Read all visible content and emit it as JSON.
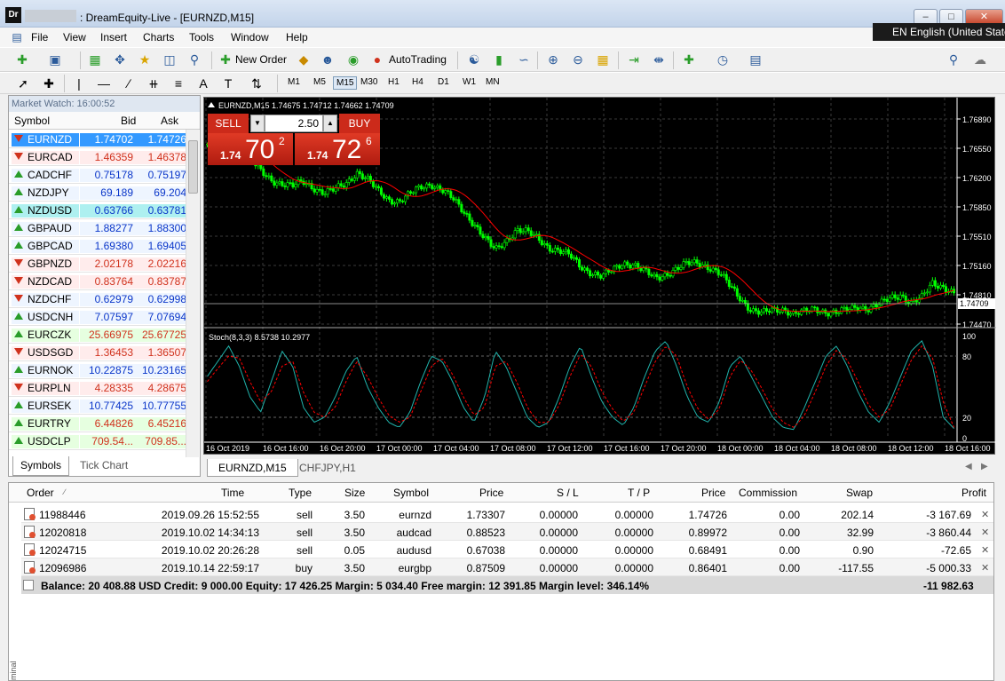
{
  "window": {
    "app_badge": "Dr",
    "title": ": DreamEquity-Live - [EURNZD,M15]",
    "language": "EN English (United States)"
  },
  "menu": [
    "File",
    "View",
    "Insert",
    "Charts",
    "Tools",
    "Window",
    "Help"
  ],
  "toolbar": {
    "new_order": "New Order",
    "auto_trading": "AutoTrading",
    "timeframes": [
      "M1",
      "M5",
      "M15",
      "M30",
      "H1",
      "H4",
      "D1",
      "W1",
      "MN"
    ],
    "active_timeframe": "M15"
  },
  "market_watch": {
    "title": "Market Watch: 16:00:52",
    "headers": {
      "symbol": "Symbol",
      "bid": "Bid",
      "ask": "Ask"
    },
    "rows": [
      {
        "symbol": "EURNZD",
        "bid": "1.74702",
        "ask": "1.74726",
        "dir": "down",
        "style": "selected"
      },
      {
        "symbol": "EURCAD",
        "bid": "1.46359",
        "ask": "1.46378",
        "dir": "down",
        "style": "red"
      },
      {
        "symbol": "CADCHF",
        "bid": "0.75178",
        "ask": "0.75197",
        "dir": "up",
        "style": "blue"
      },
      {
        "symbol": "NZDJPY",
        "bid": "69.189",
        "ask": "69.204",
        "dir": "up",
        "style": "blue"
      },
      {
        "symbol": "NZDUSD",
        "bid": "0.63766",
        "ask": "0.63781",
        "dir": "up",
        "style": "cyan"
      },
      {
        "symbol": "GBPAUD",
        "bid": "1.88277",
        "ask": "1.88300",
        "dir": "up",
        "style": "blue"
      },
      {
        "symbol": "GBPCAD",
        "bid": "1.69380",
        "ask": "1.69405",
        "dir": "up",
        "style": "blue"
      },
      {
        "symbol": "GBPNZD",
        "bid": "2.02178",
        "ask": "2.02216",
        "dir": "down",
        "style": "red"
      },
      {
        "symbol": "NZDCAD",
        "bid": "0.83764",
        "ask": "0.83787",
        "dir": "down",
        "style": "red"
      },
      {
        "symbol": "NZDCHF",
        "bid": "0.62979",
        "ask": "0.62998",
        "dir": "down",
        "style": "blue"
      },
      {
        "symbol": "USDCNH",
        "bid": "7.07597",
        "ask": "7.07694",
        "dir": "up",
        "style": "blue"
      },
      {
        "symbol": "EURCZK",
        "bid": "25.66975",
        "ask": "25.67725",
        "dir": "up",
        "style": "green"
      },
      {
        "symbol": "USDSGD",
        "bid": "1.36453",
        "ask": "1.36507",
        "dir": "down",
        "style": "red"
      },
      {
        "symbol": "EURNOK",
        "bid": "10.22875",
        "ask": "10.23165",
        "dir": "up",
        "style": "blue"
      },
      {
        "symbol": "EURPLN",
        "bid": "4.28335",
        "ask": "4.28675",
        "dir": "down",
        "style": "red"
      },
      {
        "symbol": "EURSEK",
        "bid": "10.77425",
        "ask": "10.77755",
        "dir": "up",
        "style": "blue"
      },
      {
        "symbol": "EURTRY",
        "bid": "6.44826",
        "ask": "6.45216",
        "dir": "up",
        "style": "green"
      },
      {
        "symbol": "USDCLP",
        "bid": "709.54...",
        "ask": "709.85...",
        "dir": "up",
        "style": "green"
      }
    ],
    "tabs": [
      "Symbols",
      "Tick Chart"
    ]
  },
  "chart": {
    "header": "EURNZD,M15  1.74675 1.74712 1.74662 1.74709",
    "sell_label": "SELL",
    "buy_label": "BUY",
    "lot": "2.50",
    "sell_price": {
      "prefix": "1.74",
      "big": "70",
      "sup": "2"
    },
    "buy_price": {
      "prefix": "1.74",
      "big": "72",
      "sup": "6"
    },
    "price_ticks": [
      "1.76890",
      "1.76550",
      "1.76200",
      "1.75850",
      "1.75510",
      "1.75160",
      "1.74810",
      "1.74470"
    ],
    "current_price": "1.74709",
    "stoch_label": "Stoch(8,3,3) 8.5738 10.2977",
    "stoch_ticks": [
      "100",
      "80",
      "20",
      "0"
    ],
    "time_ticks": [
      "16 Oct 2019",
      "16 Oct 16:00",
      "16 Oct 20:00",
      "17 Oct 00:00",
      "17 Oct 04:00",
      "17 Oct 08:00",
      "17 Oct 12:00",
      "17 Oct 16:00",
      "17 Oct 20:00",
      "18 Oct 00:00",
      "18 Oct 04:00",
      "18 Oct 08:00",
      "18 Oct 12:00",
      "18 Oct 16:00"
    ],
    "tabs": [
      "EURNZD,M15",
      "CHFJPY,H1"
    ],
    "colors": {
      "bull": "#00ff00",
      "bear": "#00ff00",
      "ma": "#ff0000",
      "stoch_main": "#20b2aa",
      "stoch_signal": "#ff0000",
      "grid": "#3a3a3a"
    }
  },
  "chart_data": {
    "type": "candlestick",
    "price_range": [
      1.743,
      1.7705
    ],
    "close_path": [
      1.766,
      1.7668,
      1.7672,
      1.765,
      1.764,
      1.7625,
      1.7615,
      1.761,
      1.7606,
      1.7612,
      1.7605,
      1.7598,
      1.7602,
      1.761,
      1.7625,
      1.7615,
      1.76,
      1.759,
      1.7588,
      1.7596,
      1.7605,
      1.761,
      1.7602,
      1.759,
      1.7575,
      1.756,
      1.754,
      1.7525,
      1.7538,
      1.7552,
      1.7548,
      1.754,
      1.753,
      1.7525,
      1.7518,
      1.7505,
      1.7498,
      1.7492,
      1.75,
      1.751,
      1.7508,
      1.7498,
      1.749,
      1.7496,
      1.7502,
      1.7508,
      1.751,
      1.7505,
      1.7496,
      1.748,
      1.7465,
      1.745,
      1.7445,
      1.745,
      1.7452,
      1.7445,
      1.7447,
      1.7452,
      1.7448,
      1.7446,
      1.745,
      1.7455,
      1.7452,
      1.7456,
      1.7465,
      1.747,
      1.7458,
      1.7465,
      1.7485,
      1.748,
      1.747
    ],
    "stochastic": {
      "main": [
        60,
        75,
        90,
        70,
        40,
        25,
        55,
        85,
        70,
        30,
        15,
        20,
        40,
        65,
        80,
        50,
        30,
        15,
        10,
        25,
        55,
        80,
        75,
        55,
        30,
        15,
        40,
        85,
        70,
        45,
        20,
        10,
        15,
        40,
        70,
        90,
        60,
        35,
        20,
        12,
        30,
        60,
        85,
        95,
        70,
        40,
        20,
        15,
        35,
        70,
        80,
        60,
        40,
        20,
        10,
        8,
        30,
        55,
        80,
        90,
        70,
        45,
        25,
        15,
        35,
        60,
        85,
        95,
        70,
        20,
        9
      ],
      "signal": [
        55,
        68,
        80,
        78,
        55,
        35,
        45,
        70,
        75,
        45,
        25,
        20,
        30,
        55,
        75,
        60,
        40,
        22,
        15,
        20,
        45,
        70,
        78,
        62,
        40,
        22,
        30,
        70,
        75,
        55,
        30,
        15,
        15,
        32,
        60,
        82,
        70,
        45,
        28,
        16,
        25,
        50,
        75,
        90,
        80,
        50,
        28,
        18,
        28,
        60,
        76,
        66,
        48,
        28,
        15,
        10,
        22,
        45,
        70,
        86,
        76,
        55,
        32,
        20,
        28,
        52,
        76,
        90,
        78,
        35,
        10
      ]
    }
  },
  "orders": {
    "headers": [
      "Order",
      "Time",
      "Type",
      "Size",
      "Symbol",
      "Price",
      "S / L",
      "T / P",
      "Price",
      "Commission",
      "Swap",
      "Profit"
    ],
    "rows": [
      {
        "order": "11988446",
        "time": "2019.09.26 15:52:55",
        "type": "sell",
        "size": "3.50",
        "symbol": "eurnzd",
        "price": "1.73307",
        "sl": "0.00000",
        "tp": "0.00000",
        "cur": "1.74726",
        "commission": "0.00",
        "swap": "202.14",
        "profit": "-3 167.69"
      },
      {
        "order": "12020818",
        "time": "2019.10.02 14:34:13",
        "type": "sell",
        "size": "3.50",
        "symbol": "audcad",
        "price": "0.88523",
        "sl": "0.00000",
        "tp": "0.00000",
        "cur": "0.89972",
        "commission": "0.00",
        "swap": "32.99",
        "profit": "-3 860.44"
      },
      {
        "order": "12024715",
        "time": "2019.10.02 20:26:28",
        "type": "sell",
        "size": "0.05",
        "symbol": "audusd",
        "price": "0.67038",
        "sl": "0.00000",
        "tp": "0.00000",
        "cur": "0.68491",
        "commission": "0.00",
        "swap": "0.90",
        "profit": "-72.65"
      },
      {
        "order": "12096986",
        "time": "2019.10.14 22:59:17",
        "type": "buy",
        "size": "3.50",
        "symbol": "eurgbp",
        "price": "0.87509",
        "sl": "0.00000",
        "tp": "0.00000",
        "cur": "0.86401",
        "commission": "0.00",
        "swap": "-117.55",
        "profit": "-5 000.33"
      }
    ],
    "balance_line": "Balance: 20 408.88 USD  Credit: 9 000.00  Equity: 17 426.25  Margin: 5 034.40  Free margin: 12 391.85  Margin level: 346.14%",
    "total_profit": "-11 982.63",
    "side_label": "minal"
  }
}
